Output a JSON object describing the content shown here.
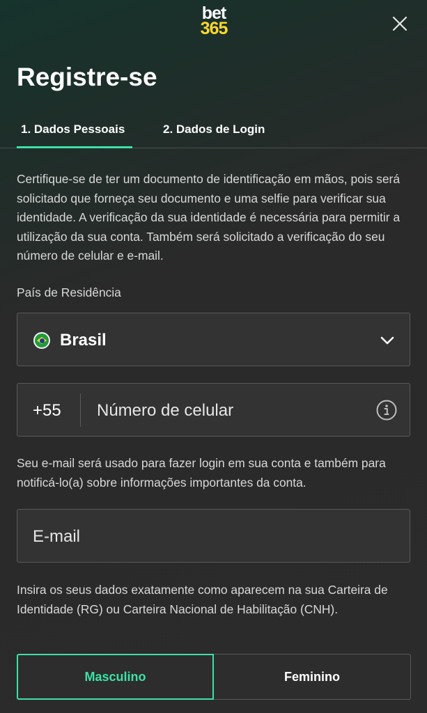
{
  "header": {
    "logo_line1": "bet",
    "logo_line2": "365",
    "title": "Registre-se"
  },
  "tabs": [
    {
      "label": "1.  Dados Pessoais",
      "active": true
    },
    {
      "label": "2.  Dados de Login",
      "active": false
    }
  ],
  "intro_text": "Certifique-se de ter um documento de identificação em mãos, pois será solicitado que forneça seu documento e uma selfie para verificar sua identidade. A verificação da sua identidade é necessária para permitir a utilização da sua conta. Também será solicitado a verificação do seu número de celular e e-mail.",
  "country": {
    "label": "País de Residência",
    "value": "Brasil",
    "flag_icon": "brazil-flag-icon"
  },
  "phone": {
    "dial_code": "+55",
    "placeholder": "Número de celular"
  },
  "email": {
    "note": "Seu e-mail será usado para fazer login em sua conta e também para notificá-lo(a) sobre informações importantes da conta.",
    "placeholder": "E-mail"
  },
  "identity_note": "Insira os seus dados exatamente como aparecem na sua Carteira de Identidade (RG) ou Carteira Nacional de Habilitação (CNH).",
  "gender": {
    "options": [
      "Masculino",
      "Feminino"
    ],
    "selected": "Masculino"
  },
  "colors": {
    "accent": "#3ee0a6",
    "brand_yellow": "#ffd92c",
    "background": "#2b2b2b",
    "field_bg": "#333333"
  }
}
